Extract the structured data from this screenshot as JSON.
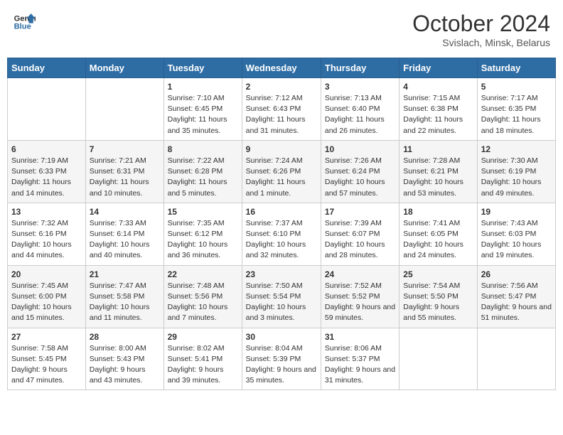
{
  "header": {
    "logo_general": "General",
    "logo_blue": "Blue",
    "month_title": "October 2024",
    "location": "Svislach, Minsk, Belarus"
  },
  "weekdays": [
    "Sunday",
    "Monday",
    "Tuesday",
    "Wednesday",
    "Thursday",
    "Friday",
    "Saturday"
  ],
  "weeks": [
    [
      {
        "day": "",
        "info": ""
      },
      {
        "day": "",
        "info": ""
      },
      {
        "day": "1",
        "info": "Sunrise: 7:10 AM\nSunset: 6:45 PM\nDaylight: 11 hours and 35 minutes."
      },
      {
        "day": "2",
        "info": "Sunrise: 7:12 AM\nSunset: 6:43 PM\nDaylight: 11 hours and 31 minutes."
      },
      {
        "day": "3",
        "info": "Sunrise: 7:13 AM\nSunset: 6:40 PM\nDaylight: 11 hours and 26 minutes."
      },
      {
        "day": "4",
        "info": "Sunrise: 7:15 AM\nSunset: 6:38 PM\nDaylight: 11 hours and 22 minutes."
      },
      {
        "day": "5",
        "info": "Sunrise: 7:17 AM\nSunset: 6:35 PM\nDaylight: 11 hours and 18 minutes."
      }
    ],
    [
      {
        "day": "6",
        "info": "Sunrise: 7:19 AM\nSunset: 6:33 PM\nDaylight: 11 hours and 14 minutes."
      },
      {
        "day": "7",
        "info": "Sunrise: 7:21 AM\nSunset: 6:31 PM\nDaylight: 11 hours and 10 minutes."
      },
      {
        "day": "8",
        "info": "Sunrise: 7:22 AM\nSunset: 6:28 PM\nDaylight: 11 hours and 5 minutes."
      },
      {
        "day": "9",
        "info": "Sunrise: 7:24 AM\nSunset: 6:26 PM\nDaylight: 11 hours and 1 minute."
      },
      {
        "day": "10",
        "info": "Sunrise: 7:26 AM\nSunset: 6:24 PM\nDaylight: 10 hours and 57 minutes."
      },
      {
        "day": "11",
        "info": "Sunrise: 7:28 AM\nSunset: 6:21 PM\nDaylight: 10 hours and 53 minutes."
      },
      {
        "day": "12",
        "info": "Sunrise: 7:30 AM\nSunset: 6:19 PM\nDaylight: 10 hours and 49 minutes."
      }
    ],
    [
      {
        "day": "13",
        "info": "Sunrise: 7:32 AM\nSunset: 6:16 PM\nDaylight: 10 hours and 44 minutes."
      },
      {
        "day": "14",
        "info": "Sunrise: 7:33 AM\nSunset: 6:14 PM\nDaylight: 10 hours and 40 minutes."
      },
      {
        "day": "15",
        "info": "Sunrise: 7:35 AM\nSunset: 6:12 PM\nDaylight: 10 hours and 36 minutes."
      },
      {
        "day": "16",
        "info": "Sunrise: 7:37 AM\nSunset: 6:10 PM\nDaylight: 10 hours and 32 minutes."
      },
      {
        "day": "17",
        "info": "Sunrise: 7:39 AM\nSunset: 6:07 PM\nDaylight: 10 hours and 28 minutes."
      },
      {
        "day": "18",
        "info": "Sunrise: 7:41 AM\nSunset: 6:05 PM\nDaylight: 10 hours and 24 minutes."
      },
      {
        "day": "19",
        "info": "Sunrise: 7:43 AM\nSunset: 6:03 PM\nDaylight: 10 hours and 19 minutes."
      }
    ],
    [
      {
        "day": "20",
        "info": "Sunrise: 7:45 AM\nSunset: 6:00 PM\nDaylight: 10 hours and 15 minutes."
      },
      {
        "day": "21",
        "info": "Sunrise: 7:47 AM\nSunset: 5:58 PM\nDaylight: 10 hours and 11 minutes."
      },
      {
        "day": "22",
        "info": "Sunrise: 7:48 AM\nSunset: 5:56 PM\nDaylight: 10 hours and 7 minutes."
      },
      {
        "day": "23",
        "info": "Sunrise: 7:50 AM\nSunset: 5:54 PM\nDaylight: 10 hours and 3 minutes."
      },
      {
        "day": "24",
        "info": "Sunrise: 7:52 AM\nSunset: 5:52 PM\nDaylight: 9 hours and 59 minutes."
      },
      {
        "day": "25",
        "info": "Sunrise: 7:54 AM\nSunset: 5:50 PM\nDaylight: 9 hours and 55 minutes."
      },
      {
        "day": "26",
        "info": "Sunrise: 7:56 AM\nSunset: 5:47 PM\nDaylight: 9 hours and 51 minutes."
      }
    ],
    [
      {
        "day": "27",
        "info": "Sunrise: 7:58 AM\nSunset: 5:45 PM\nDaylight: 9 hours and 47 minutes."
      },
      {
        "day": "28",
        "info": "Sunrise: 8:00 AM\nSunset: 5:43 PM\nDaylight: 9 hours and 43 minutes."
      },
      {
        "day": "29",
        "info": "Sunrise: 8:02 AM\nSunset: 5:41 PM\nDaylight: 9 hours and 39 minutes."
      },
      {
        "day": "30",
        "info": "Sunrise: 8:04 AM\nSunset: 5:39 PM\nDaylight: 9 hours and 35 minutes."
      },
      {
        "day": "31",
        "info": "Sunrise: 8:06 AM\nSunset: 5:37 PM\nDaylight: 9 hours and 31 minutes."
      },
      {
        "day": "",
        "info": ""
      },
      {
        "day": "",
        "info": ""
      }
    ]
  ]
}
